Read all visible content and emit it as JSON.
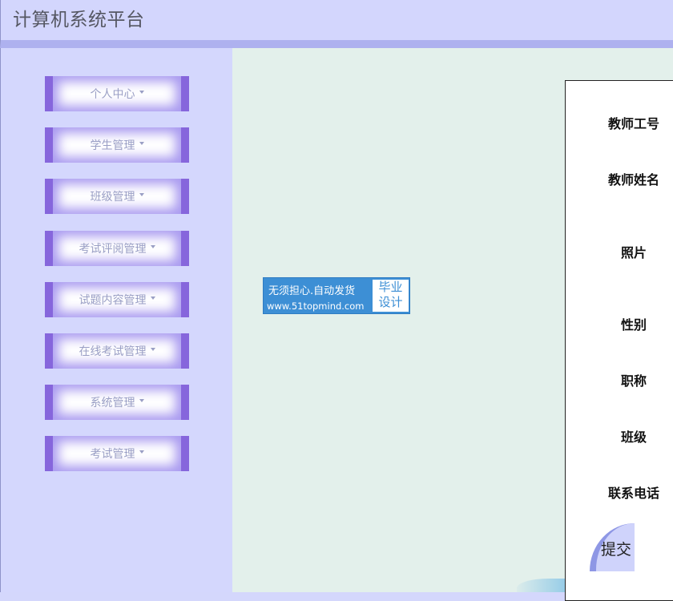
{
  "header": {
    "title": "计算机系统平台"
  },
  "sidebar": {
    "items": [
      {
        "label": "个人中心"
      },
      {
        "label": "学生管理"
      },
      {
        "label": "班级管理"
      },
      {
        "label": "考试评阅管理"
      },
      {
        "label": "试题内容管理"
      },
      {
        "label": "在线考试管理"
      },
      {
        "label": "系统管理"
      },
      {
        "label": "考试管理"
      }
    ]
  },
  "badge": {
    "line1": "无须担心.自动发货",
    "line2": "www.51topmind.com",
    "right_top": "毕业",
    "right_bottom": "设计"
  },
  "form": {
    "fields": [
      {
        "label": "教师工号"
      },
      {
        "label": "教师姓名"
      },
      {
        "label": "照片"
      },
      {
        "label": "性别"
      },
      {
        "label": "职称"
      },
      {
        "label": "班级"
      },
      {
        "label": "联系电话"
      }
    ],
    "submit_label": "提交"
  },
  "colors": {
    "header_bg": "#d3d6fd",
    "sidebar_bg": "#d4d7fd",
    "main_bg": "#e3f0eb",
    "menu_accent": "#8666dc",
    "badge_blue": "#3d8fd5"
  }
}
